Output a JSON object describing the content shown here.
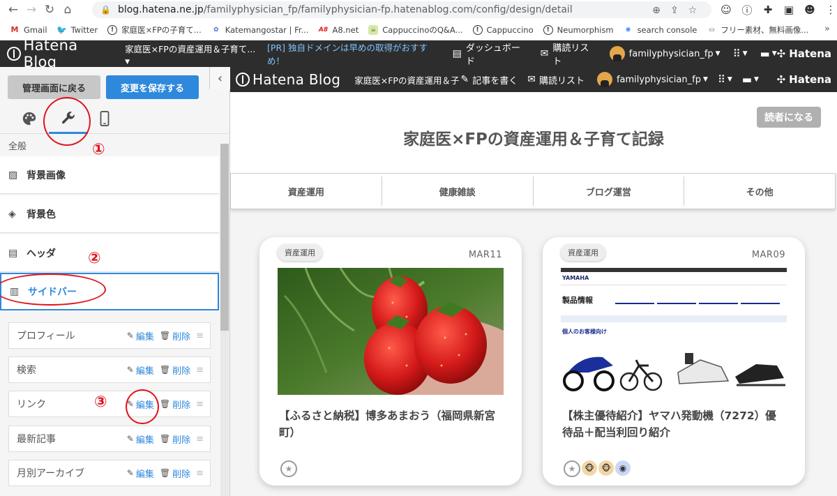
{
  "browser": {
    "url_host": "blog.hatena.ne.jp",
    "url_path": "/familyphysician_fp/familyphysician-fp.hatenablog.com/config/design/detail",
    "bookmarks": [
      {
        "label": "Gmail",
        "icon": "gmail-icon",
        "color": "#d93025"
      },
      {
        "label": "Twitter",
        "icon": "twitter-icon",
        "color": "#1d9bf0"
      },
      {
        "label": "家庭医×FPの子育て...",
        "icon": "hatena-icon",
        "color": "#333333"
      },
      {
        "label": "Katemangostar | Fr...",
        "icon": "katemangostar-icon",
        "color": "#3b6fd8"
      },
      {
        "label": "A8.net",
        "icon": "a8-icon",
        "color": "#e01c1c"
      },
      {
        "label": "CappuccinoのQ&A...",
        "icon": "cappuccino-qa-icon",
        "color": "#7a9f2c"
      },
      {
        "label": "Cappuccino",
        "icon": "hatena-icon",
        "color": "#333333"
      },
      {
        "label": "Neumorphism",
        "icon": "hatena-icon",
        "color": "#333333"
      },
      {
        "label": "search console",
        "icon": "search-console-icon",
        "color": "#4285f4"
      },
      {
        "label": "フリー素材、無料画像...",
        "icon": "free-material-icon",
        "color": "#555555"
      }
    ]
  },
  "topbar": {
    "logo": "Hatena Blog",
    "blog_name": "家庭医×FPの資産運用＆子育て...",
    "pr_text": "[PR] 独自ドメインは早めの取得がおすすめ！",
    "dashboard": "ダッシュボード",
    "subscribe": "購読リスト",
    "user": "familyphysician_fp",
    "brand": "Hatena"
  },
  "sidebar": {
    "back_button": "管理画面に戻る",
    "save_button": "変更を保存する",
    "section": "全般",
    "menu": [
      {
        "label": "背景画像",
        "icon": "image-icon"
      },
      {
        "label": "背景色",
        "icon": "paint-bucket-icon"
      },
      {
        "label": "ヘッダ",
        "icon": "header-layout-icon"
      },
      {
        "label": "サイドバー",
        "icon": "sidebar-layout-icon"
      }
    ],
    "widgets": [
      {
        "name": "プロフィール"
      },
      {
        "name": "検索"
      },
      {
        "name": "リンク"
      },
      {
        "name": "最新記事"
      },
      {
        "name": "月別アーカイブ"
      }
    ],
    "edit_label": "編集",
    "delete_label": "削除"
  },
  "annotations": {
    "n1": "①",
    "n2": "②",
    "n3": "③",
    "color": "#e0141e"
  },
  "preview": {
    "logo": "Hatena Blog",
    "blog_name": "家庭医×FPの資産運用＆子",
    "write": "記事を書く",
    "subscribe": "購読リスト",
    "user": "familyphysician_fp",
    "brand": "Hatena",
    "reader_button": "読者になる",
    "title": "家庭医×FPの資産運用＆子育て記録",
    "nav": [
      "資産運用",
      "健康雑談",
      "ブログ運営",
      "その他"
    ],
    "cards": [
      {
        "category": "資産運用",
        "date": "MAR11",
        "title": "【ふるさと納税】博多あまおう（福岡県新宮町）"
      },
      {
        "category": "資産運用",
        "date": "MAR09",
        "title": "【株主優待紹介】ヤマハ発動機（7272）優待品＋配当利回り紹介"
      }
    ],
    "yamaha": {
      "brand": "YAMAHA",
      "heading": "製品情報",
      "sub": "個人のお客様向け"
    }
  },
  "colors": {
    "accent": "#2e88dc",
    "topbar": "#2d2d2d"
  }
}
